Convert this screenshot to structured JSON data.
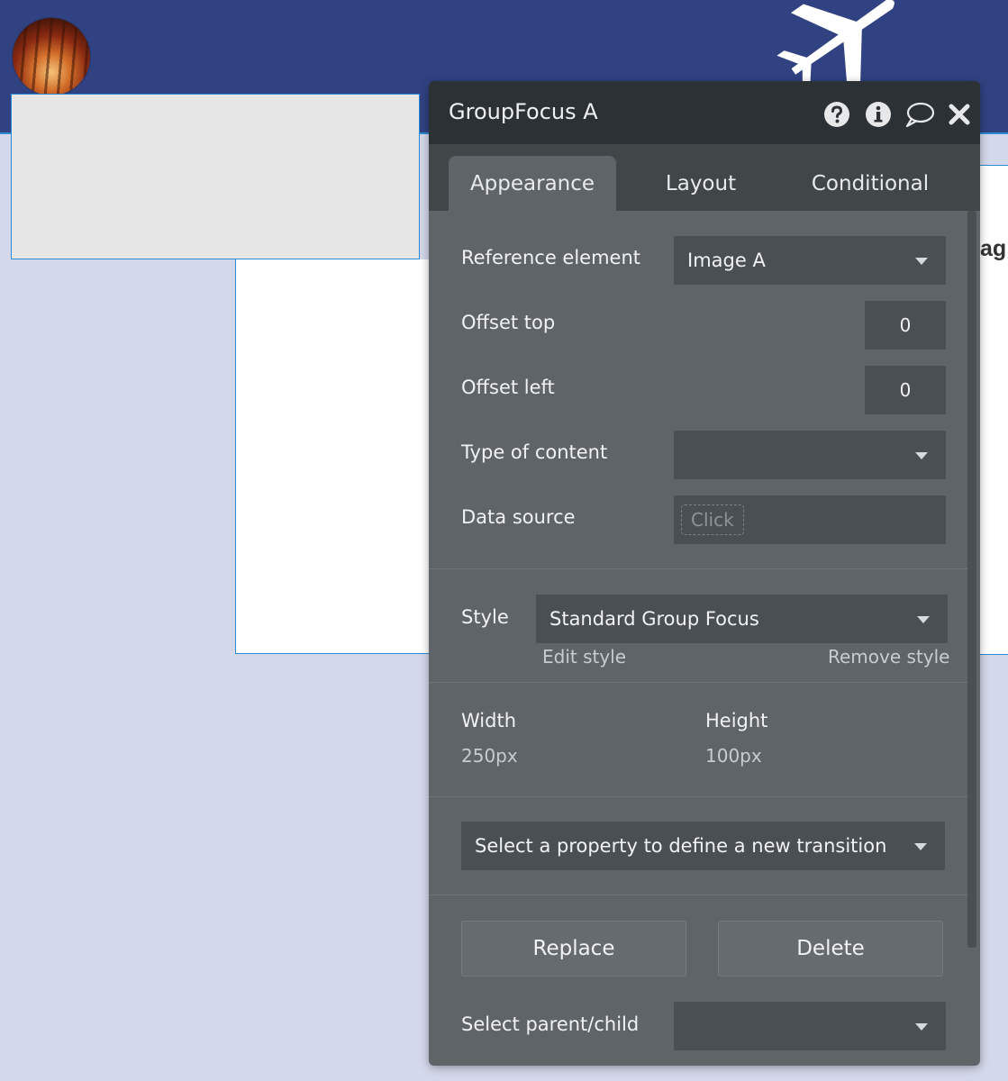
{
  "background": {
    "right_partial_text": "ag"
  },
  "panel": {
    "title": "GroupFocus A",
    "icons": [
      "help-icon",
      "info-icon",
      "comment-icon",
      "close-icon"
    ],
    "tabs": [
      {
        "label": "Appearance",
        "active": true
      },
      {
        "label": "Layout",
        "active": false
      },
      {
        "label": "Conditional",
        "active": false
      }
    ],
    "reference_element": {
      "label": "Reference element",
      "value": "Image A"
    },
    "offset_top": {
      "label": "Offset top",
      "value": "0"
    },
    "offset_left": {
      "label": "Offset left",
      "value": "0"
    },
    "type_of_content": {
      "label": "Type of content",
      "value": ""
    },
    "data_source": {
      "label": "Data source",
      "placeholder": "Click"
    },
    "style": {
      "label": "Style",
      "value": "Standard Group Focus",
      "edit_label": "Edit style",
      "remove_label": "Remove style"
    },
    "width": {
      "label": "Width",
      "value": "250px"
    },
    "height": {
      "label": "Height",
      "value": "100px"
    },
    "transition": {
      "placeholder": "Select a property to define a new transition"
    },
    "replace_label": "Replace",
    "delete_label": "Delete",
    "parent_child": {
      "label": "Select parent/child",
      "value": ""
    }
  },
  "colors": {
    "header_bar": "#314282",
    "canvas": "#d3d8ea",
    "selection_border": "#2d8ad4",
    "panel_bg": "#5f6468",
    "panel_header": "#2b3134"
  }
}
